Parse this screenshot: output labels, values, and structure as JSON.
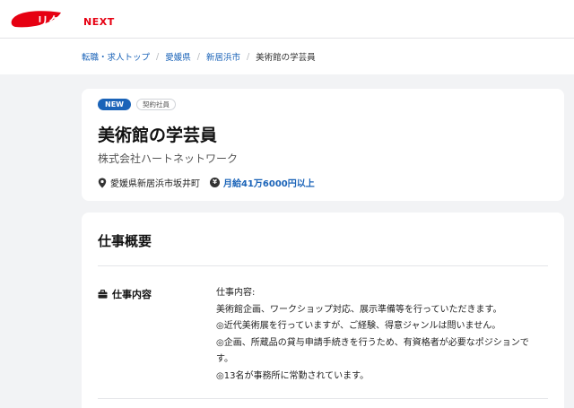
{
  "header": {
    "logo_text_prefix": "リクナビ",
    "logo_text_suffix": "NEXT",
    "brand_color": "#e60012"
  },
  "breadcrumb": [
    {
      "label": "転職・求人トップ",
      "link": true
    },
    {
      "label": "愛媛県",
      "link": true
    },
    {
      "label": "新居浜市",
      "link": true
    },
    {
      "label": "美術館の学芸員",
      "link": false
    }
  ],
  "job": {
    "new_badge": "NEW",
    "employment_type": "契約社員",
    "title": "美術館の学芸員",
    "company": "株式会社ハートネットワーク",
    "location": "愛媛県新居浜市坂井町",
    "salary": "月給41万6000円以上",
    "location_icon": "pin-icon",
    "salary_icon": "yen-icon",
    "accent_color": "#1a63b8"
  },
  "overview": {
    "section_title": "仕事概要",
    "row_label": "仕事内容",
    "row_icon": "briefcase-icon",
    "lines": [
      "仕事内容:",
      "美術館企画、ワークショップ対応、展示準備等を行っていただきます。",
      "◎近代美術展を行っていますが、ご経験、得意ジャンルは問いません。",
      "◎企画、所蔵品の貸与申請手続きを行うため、有資格者が必要なポジションで",
      "す。",
      "◎13名が事務所に常勤されています。"
    ]
  }
}
